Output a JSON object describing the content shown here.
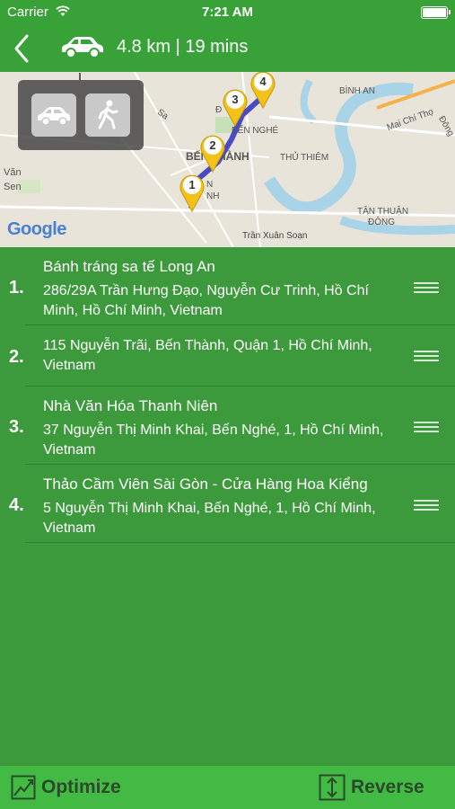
{
  "status": {
    "carrier": "Carrier",
    "time": "7:21 AM"
  },
  "nav": {
    "summary": "4.8 km | 19 mins"
  },
  "map": {
    "labels": {
      "binh_an": "BÌNH AN",
      "mai_chi_tho": "Mai Chí Thọ",
      "dong": "Đông",
      "sa": "Sa",
      "ben_nghe": "BẾN NGHÉ",
      "ben_thanh": "BẾN THÀNH",
      "thu_thiem": "THỦ THIÊM",
      "van": "Văn",
      "sen": "Sen",
      "tan_thuan": "TÂN THUẬN",
      "dong2": "ĐÔNG",
      "tran_xuan_soan": "Trần Xuân Soạn",
      "google": "Google",
      "nh": "NH",
      "n": "N",
      "d": "Đ",
      "nh2": "NH"
    },
    "markers": [
      "1",
      "2",
      "3",
      "4"
    ]
  },
  "stops": [
    {
      "num": "1.",
      "name": "Bánh tráng sa tế Long An",
      "address": "286/29A Trần Hưng Đạo, Nguyễn Cư Trinh, Hồ Chí Minh, Hồ Chí Minh, Vietnam"
    },
    {
      "num": "2.",
      "name": "",
      "address": "115 Nguyễn Trãi, Bến Thành, Quận 1, Hồ Chí Minh, Vietnam"
    },
    {
      "num": "3.",
      "name": "Nhà Văn Hóa Thanh Niên",
      "address": "37 Nguyễn Thị Minh Khai, Bến Nghé, 1, Hồ Chí Minh, Vietnam"
    },
    {
      "num": "4.",
      "name": "Thảo Cầm Viên Sài Gòn - Cửa Hàng Hoa Kiểng",
      "address": "5 Nguyễn Thị Minh Khai, Bến Nghé, 1, Hồ Chí Minh, Vietnam"
    }
  ],
  "bottom": {
    "optimize_label": "Optimize",
    "reverse_label": "Reverse"
  },
  "colors": {
    "bar": "#38a238",
    "list_bg": "#3c9a3c",
    "route": "#4a4ac8",
    "marker": "#f2c21b",
    "river": "#a9d4e8"
  },
  "icons": [
    "back-chevron-icon",
    "car-icon",
    "walk-icon",
    "drag-handle-icon",
    "optimize-chart-icon",
    "reverse-arrows-icon",
    "wifi-icon",
    "battery-icon"
  ]
}
